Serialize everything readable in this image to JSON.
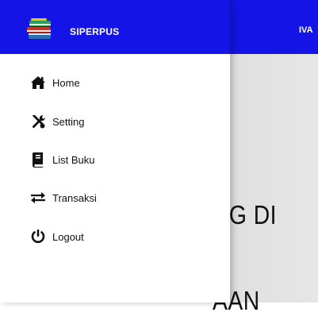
{
  "brand": {
    "name": "SIPERPUS",
    "logo_icon": "books-stack-icon"
  },
  "page": {
    "nav_partial_text": "IVA",
    "hero_lines": [
      "NG DI",
      "I",
      "AAN"
    ]
  },
  "menu": {
    "items": [
      {
        "label": "Home",
        "icon": "home-icon"
      },
      {
        "label": "Setting",
        "icon": "tools-icon"
      },
      {
        "label": "List Buku",
        "icon": "book-icon"
      },
      {
        "label": "Transaksi",
        "icon": "exchange-icon"
      },
      {
        "label": "Logout",
        "icon": "power-icon"
      }
    ]
  },
  "colors": {
    "header": "#1414e6",
    "drawer_bg": "#ffffff",
    "text": "#111111"
  }
}
